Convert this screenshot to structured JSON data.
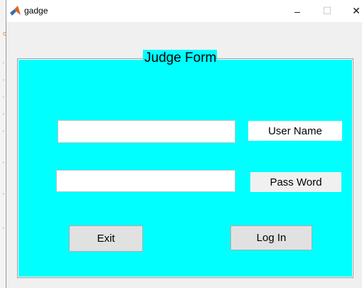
{
  "window": {
    "title": "gadge",
    "controls": {
      "minimize": "–",
      "maximize": "☐",
      "close": "✕"
    }
  },
  "form": {
    "title": "Judge Form",
    "username_label": "User Name",
    "username_value": "",
    "password_label": "Pass Word",
    "password_value": "",
    "exit_label": "Exit",
    "login_label": "Log In"
  },
  "colors": {
    "panel_bg": "#00ffff",
    "window_bg": "#f0f0f0",
    "button_bg": "#e1e1e1"
  }
}
